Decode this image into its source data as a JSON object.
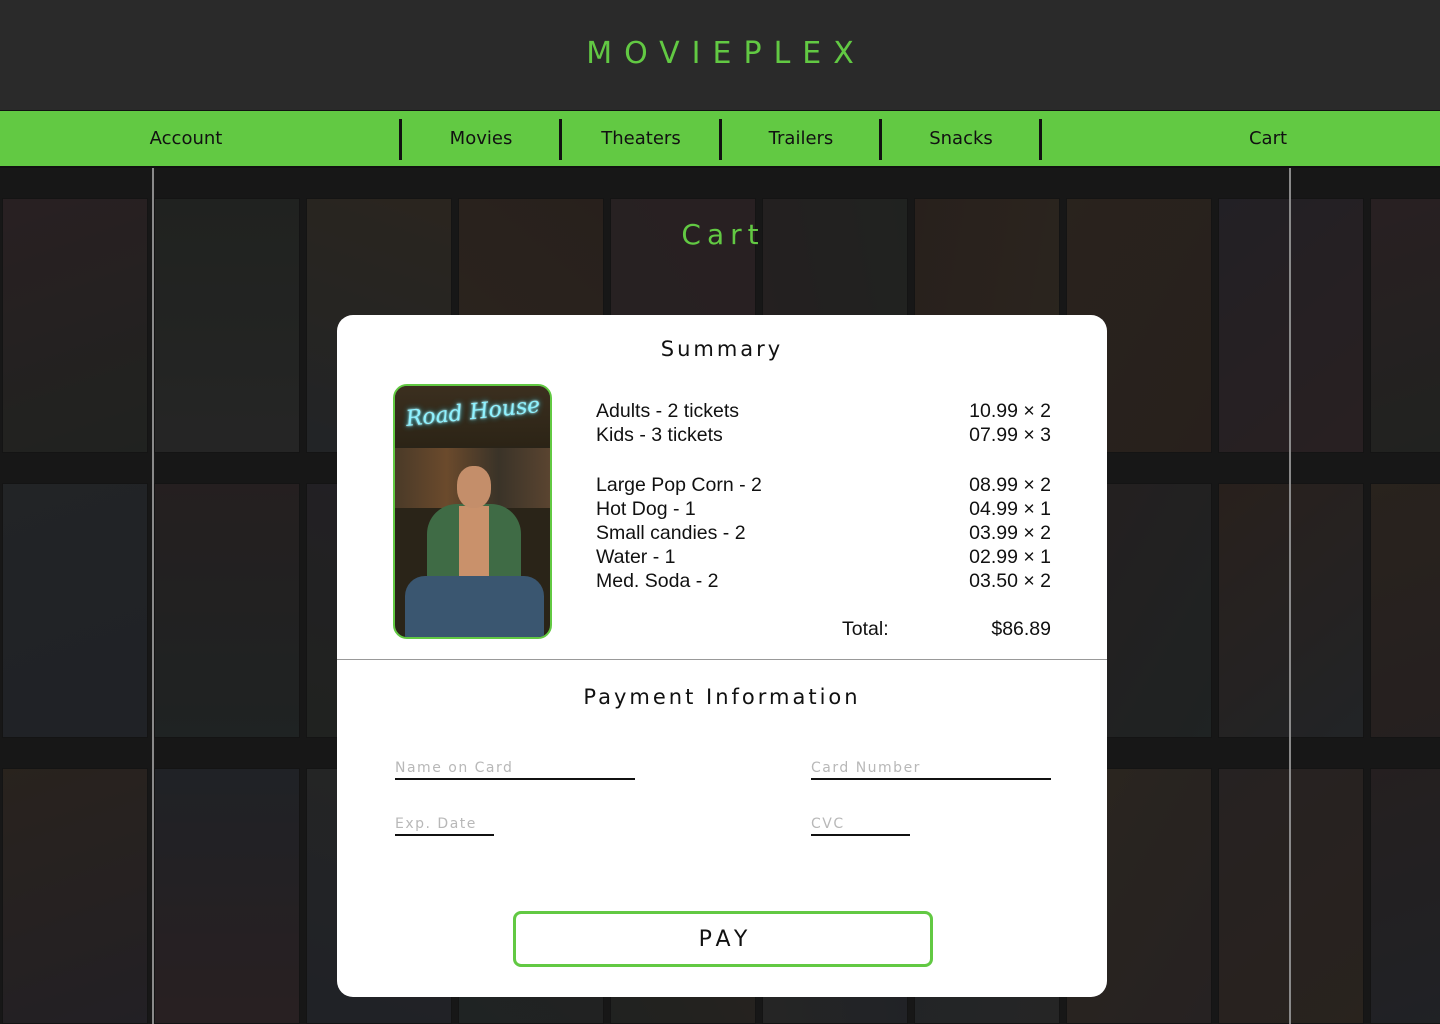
{
  "brand": {
    "name": "MOVIEPLEX",
    "color": "#62c943"
  },
  "nav": {
    "items": [
      {
        "label": "Account"
      },
      {
        "label": "Movies"
      },
      {
        "label": "Theaters"
      },
      {
        "label": "Trailers"
      },
      {
        "label": "Snacks"
      },
      {
        "label": "Cart"
      }
    ]
  },
  "page": {
    "title": "Cart"
  },
  "summary": {
    "title": "Summary",
    "poster": {
      "movie": "Road House",
      "icon": "movie-poster-image"
    },
    "tickets": [
      {
        "label": "Adults - 2 tickets",
        "price": "10.99 × 2"
      },
      {
        "label": "Kids - 3 tickets",
        "price": "07.99 × 3"
      }
    ],
    "snacks": [
      {
        "label": "Large Pop Corn - 2",
        "price": "08.99 × 2"
      },
      {
        "label": "Hot Dog - 1",
        "price": "04.99 × 1"
      },
      {
        "label": "Small candies - 2",
        "price": "03.99 × 2"
      },
      {
        "label": "Water - 1",
        "price": "02.99 × 1"
      },
      {
        "label": "Med. Soda - 2",
        "price": "03.50 × 2"
      }
    ],
    "total_label": "Total:",
    "total_value": "$86.89"
  },
  "payment": {
    "title": "Payment Information",
    "fields": {
      "name_on_card": {
        "placeholder": "Name on Card",
        "value": ""
      },
      "card_number": {
        "placeholder": "Card Number",
        "value": ""
      },
      "exp_date": {
        "placeholder": "Exp. Date",
        "value": ""
      },
      "cvc": {
        "placeholder": "CVC",
        "value": ""
      }
    },
    "pay_label": "PAY"
  }
}
